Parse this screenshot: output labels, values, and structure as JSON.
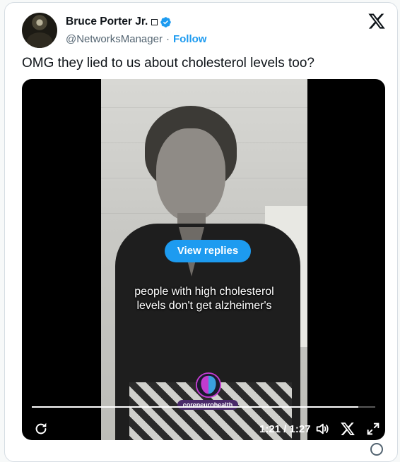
{
  "author": {
    "display_name": "Bruce Porter Jr.",
    "handle": "@NetworksManager",
    "separator": "·",
    "follow_label": "Follow"
  },
  "tweet": {
    "text": "OMG they lied to us about cholesterol levels too?"
  },
  "video": {
    "view_replies_label": "View replies",
    "caption_line1": "people with high cholesterol",
    "caption_line2": "levels don't get alzheimer's",
    "watermark": "coreneurohealth",
    "progress_fraction": 0.95,
    "time_display": "1:21 / 1:27"
  },
  "icons": {
    "close": "x-logo-icon",
    "verified": "verified-badge-icon",
    "replay": "replay-icon",
    "volume": "volume-icon",
    "fullscreen": "fullscreen-icon"
  },
  "colors": {
    "accent": "#1d9bf0",
    "text_primary": "#0f1419",
    "text_secondary": "#536471"
  }
}
